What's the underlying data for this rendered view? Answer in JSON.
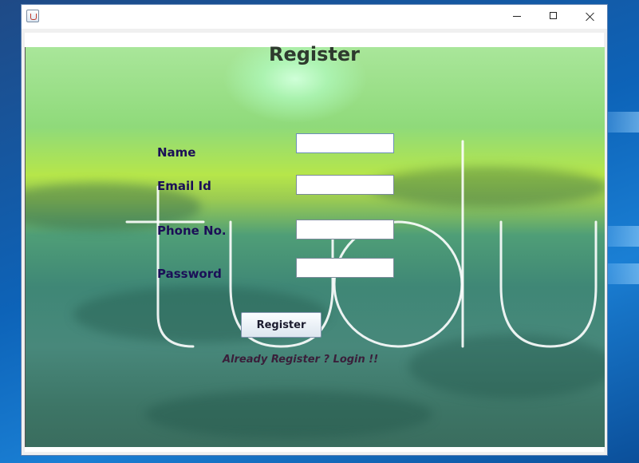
{
  "window": {
    "app_icon": "java-cup-icon",
    "controls": [
      "minimize-icon",
      "maximize-icon",
      "close-icon"
    ]
  },
  "form": {
    "title": "Register",
    "labels": {
      "name": "Name",
      "email": "Email Id",
      "phone": "Phone No.",
      "password": "Password"
    },
    "values": {
      "name": "",
      "email": "",
      "phone": "",
      "password": ""
    },
    "register_button": "Register",
    "login_link": "Already Register ? Login !!"
  },
  "background": {
    "watermark": "tudu",
    "colors": {
      "label": "#1b0f57",
      "sky": "#a9e69a",
      "sea": "#3f8776"
    }
  }
}
